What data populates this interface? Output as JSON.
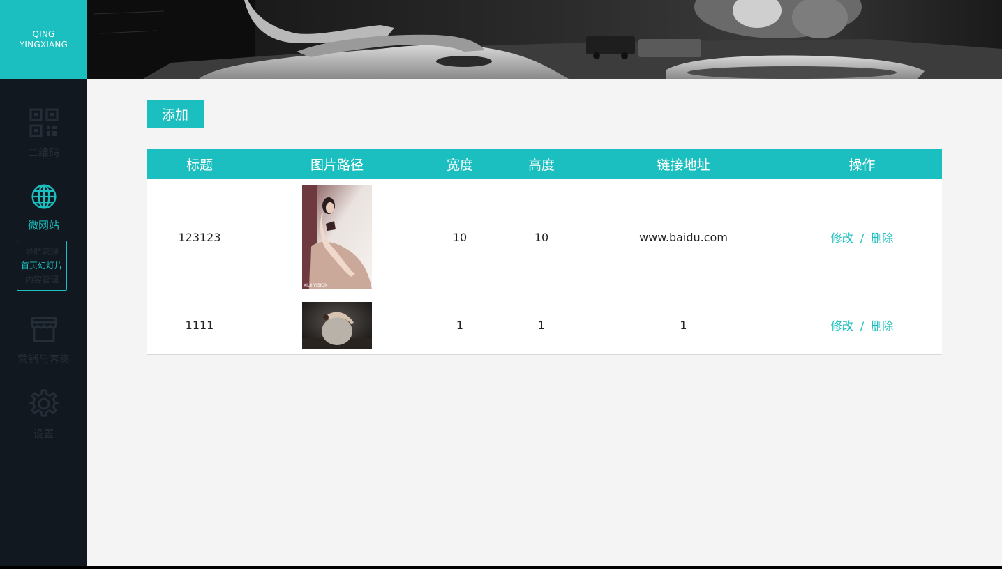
{
  "logo": {
    "line1": "QING",
    "line2": "YINGXIANG"
  },
  "sidebar": {
    "items": [
      {
        "label": "二维码",
        "icon": "qrcode-icon"
      },
      {
        "label": "微网站",
        "icon": "globe-icon"
      },
      {
        "label": "营销与客资",
        "icon": "store-icon"
      },
      {
        "label": "设置",
        "icon": "gear-icon"
      }
    ],
    "submenu": [
      "导航管理",
      "首页幻灯片",
      "内容管理"
    ]
  },
  "toolbar": {
    "add_label": "添加"
  },
  "table": {
    "headers": [
      "标题",
      "图片路径",
      "宽度",
      "高度",
      "链接地址",
      "操作"
    ],
    "rows": [
      {
        "title": "123123",
        "width": "10",
        "height": "10",
        "link": "www.baidu.com",
        "edit": "修改",
        "sep": "/",
        "delete": "删除"
      },
      {
        "title": "1111",
        "width": "1",
        "height": "1",
        "link": "1",
        "edit": "修改",
        "sep": "/",
        "delete": "删除"
      }
    ]
  },
  "colors": {
    "accent": "#1bbfbf",
    "sidebar_bg": "#111820",
    "content_bg": "#f4f4f4"
  }
}
